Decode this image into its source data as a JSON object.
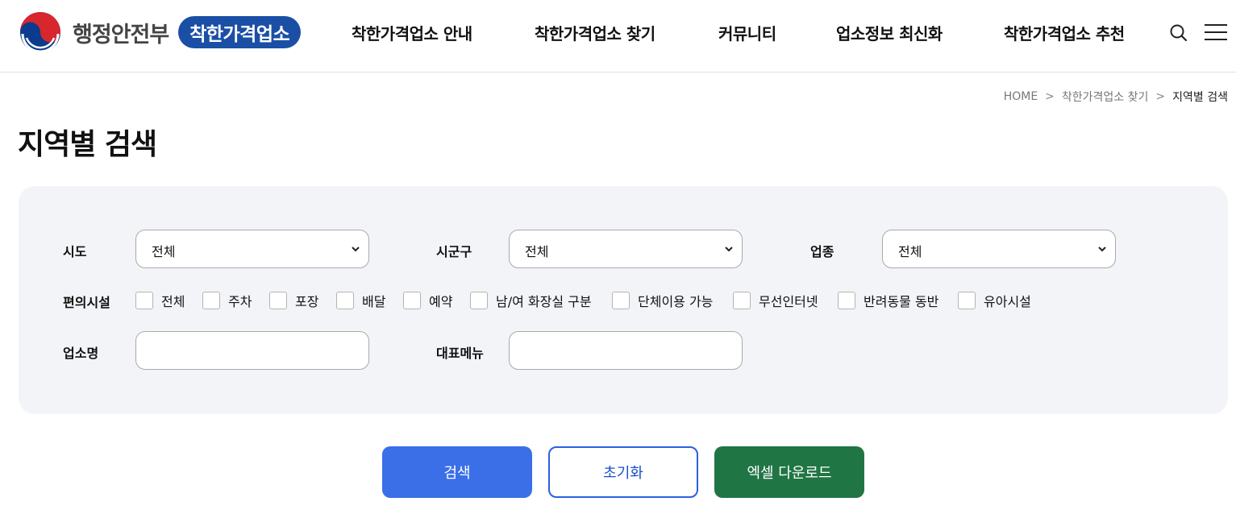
{
  "header": {
    "ministry": "행정안전부",
    "brand": "착한가격업소",
    "nav": [
      {
        "label": "착한가격업소 안내"
      },
      {
        "label": "착한가격업소 찾기"
      },
      {
        "label": "커뮤니티"
      },
      {
        "label": "업소정보 최신화"
      },
      {
        "label": "착한가격업소 추천"
      }
    ],
    "icons": [
      "search-icon",
      "menu-icon"
    ]
  },
  "breadcrumb": {
    "items": [
      "HOME",
      "착한가격업소 찾기",
      "지역별 검색"
    ],
    "separator": ">"
  },
  "page_title": "지역별 검색",
  "filters": {
    "sido": {
      "label": "시도",
      "value": "전체"
    },
    "sigungu": {
      "label": "시군구",
      "value": "전체"
    },
    "industry": {
      "label": "업종",
      "value": "전체"
    },
    "facilities": {
      "label": "편의시설",
      "options": [
        {
          "label": "전체",
          "checked": false
        },
        {
          "label": "주차",
          "checked": false
        },
        {
          "label": "포장",
          "checked": false
        },
        {
          "label": "배달",
          "checked": false
        },
        {
          "label": "예약",
          "checked": false
        },
        {
          "label": "남/여 화장실 구분",
          "checked": false
        },
        {
          "label": "단체이용 가능",
          "checked": false
        },
        {
          "label": "무선인터넷",
          "checked": false
        },
        {
          "label": "반려동물 동반",
          "checked": false
        },
        {
          "label": "유아시설",
          "checked": false
        }
      ]
    },
    "shop_name": {
      "label": "업소명",
      "value": ""
    },
    "menu": {
      "label": "대표메뉴",
      "value": ""
    }
  },
  "buttons": {
    "search": "검색",
    "reset": "초기화",
    "excel": "엑셀 다운로드"
  },
  "colors": {
    "brand_blue": "#1b4fa6",
    "search_button": "#3a6fe8",
    "reset_border": "#2b60e0",
    "excel_button": "#207544",
    "panel_bg": "#f3f4f8"
  }
}
